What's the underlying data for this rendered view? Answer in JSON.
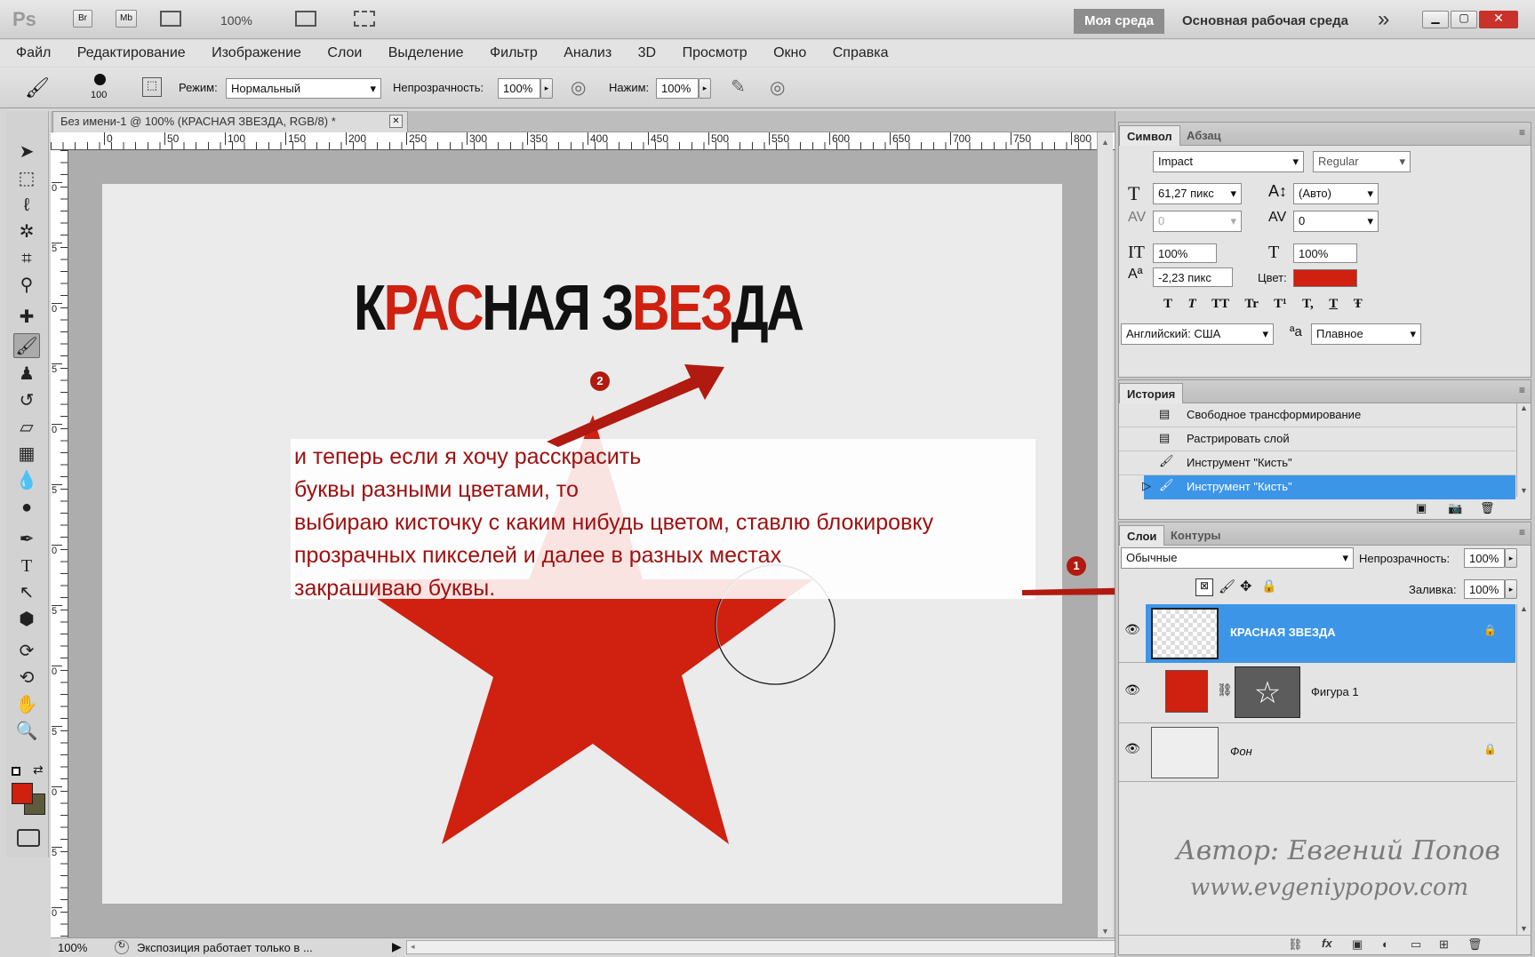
{
  "app": {
    "logo": "Ps",
    "zoom_select": "100%",
    "workspace_active": "Моя среда",
    "workspace_other": "Основная рабочая среда",
    "more": "»"
  },
  "menu": [
    "Файл",
    "Редактирование",
    "Изображение",
    "Слои",
    "Выделение",
    "Фильтр",
    "Анализ",
    "3D",
    "Просмотр",
    "Окно",
    "Справка"
  ],
  "options": {
    "brush_size": "100",
    "mode_label": "Режим:",
    "mode_value": "Нормальный",
    "opacity_label": "Непрозрачность:",
    "opacity_value": "100%",
    "flow_label": "Нажим:",
    "flow_value": "100%"
  },
  "document": {
    "tab_title": "Без имени-1 @ 100% (КРАСНАЯ ЗВЕЗДА, RGB/8) *",
    "zoom": "100%",
    "status": "Экспозиция работает только в ...",
    "ruler_h": [
      "0",
      "50",
      "100",
      "150",
      "200",
      "250",
      "300",
      "350",
      "400",
      "450",
      "500",
      "550",
      "600",
      "650",
      "700",
      "750",
      "800"
    ],
    "ruler_v": [
      "0",
      "5",
      "0",
      "5",
      "0",
      "5",
      "0",
      "5",
      "0",
      "5",
      "0",
      "5",
      "0",
      "5",
      "0",
      "5"
    ],
    "canvas_text_black_1": "К",
    "canvas_text_red_1": "РАС",
    "canvas_text_black_2": "НАЯ З",
    "canvas_text_red_2": "ВЕЗ",
    "canvas_text_black_3": "ДА"
  },
  "annotation": {
    "lines": [
      "и теперь если я хочу расскрасить",
      "буквы разными цветами, то",
      "выбираю кисточку с каким нибудь цветом, ставлю блокировку",
      "прозрачных пикселей и далее в разных местах",
      "закрашиваю буквы."
    ],
    "marker_1": "1",
    "marker_2": "2"
  },
  "symbol_panel": {
    "tab_active": "Символ",
    "tab_other": "Абзац",
    "font": "Impact",
    "style": "Regular",
    "size": "61,27 пикс",
    "leading": "(Авто)",
    "kerning": "0",
    "tracking": "0",
    "vscale": "100%",
    "hscale": "100%",
    "baseline": "-2,23 пикс",
    "color_label": "Цвет:",
    "language": "Английский: США",
    "antialias": "Плавное",
    "aa_glyph": "ªa",
    "style_buttons": [
      "T",
      "T",
      "TT",
      "Tr",
      "T¹",
      "T,",
      "T",
      "Ŧ"
    ]
  },
  "history_panel": {
    "tab": "История",
    "items": [
      "Свободное трансформирование",
      "Растрировать слой",
      "Инструмент \"Кисть\"",
      "Инструмент \"Кисть\""
    ]
  },
  "layers_panel": {
    "tab_active": "Слои",
    "tab_other": "Контуры",
    "blend": "Обычные",
    "opacity_label": "Непрозрачность:",
    "opacity_value": "100%",
    "fill_label": "Заливка:",
    "fill_value": "100%",
    "layers": [
      "КРАСНАЯ ЗВЕЗДА",
      "Фигура 1",
      "Фон"
    ]
  },
  "watermark": {
    "line1": "Автор: Евгений Попов",
    "line2": "www.evgeniypopov.com"
  },
  "colors": {
    "accent_red": "#cf2010",
    "selection_blue": "#3d95e8",
    "annotation_red": "#a01010"
  }
}
